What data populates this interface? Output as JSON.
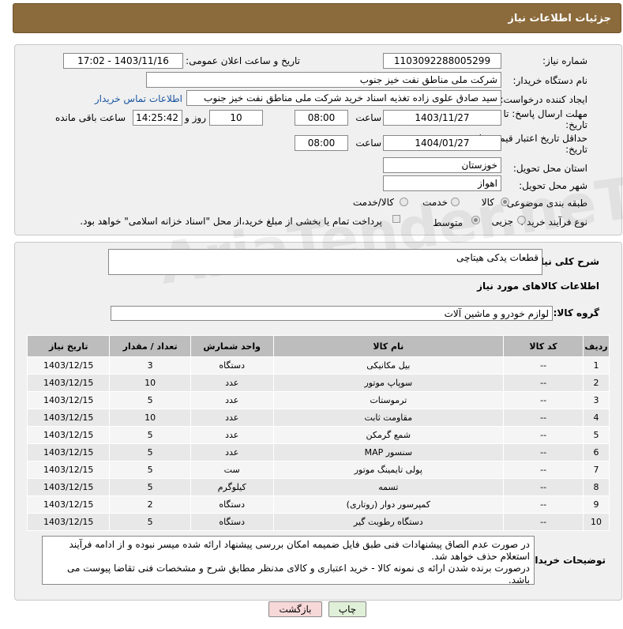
{
  "header": {
    "title": "جزئیات اطلاعات نیاز"
  },
  "form": {
    "need_number_label": "شماره نیاز:",
    "need_number": "1103092288005299",
    "announce_label": "تاریخ و ساعت اعلان عمومی:",
    "announce_value": "1403/11/16 - 17:02",
    "buyer_label": "نام دستگاه خریدار:",
    "buyer_value": "شرکت ملی مناطق نفت خیز جنوب",
    "requester_label": "ایجاد کننده درخواست:",
    "requester_value": "سید صادق علوی زاده  تغذیه اسناد خرید  شرکت ملی مناطق نفت خیز جنوب",
    "contact_link": "اطلاعات تماس خریدار",
    "deadline_label_1": "مهلت ارسال پاسخ: تا",
    "deadline_label_2": "تاریخ:",
    "deadline_date": "1403/11/27",
    "time_label": "ساعت",
    "deadline_time": "08:00",
    "days_value": "10",
    "days_label": "روز و",
    "remaining_time": "14:25:42",
    "remaining_label": "ساعت باقی مانده",
    "validity_label_1": "حداقل تاریخ اعتبار قیمت: تا",
    "validity_label_2": "تاریخ:",
    "validity_date": "1404/01/27",
    "validity_time": "08:00",
    "province_label": "استان محل تحویل:",
    "province_value": "خوزستان",
    "city_label": "شهر محل تحویل:",
    "city_value": "اهواز",
    "category_label": "طبقه بندی موضوعی:",
    "category_options": [
      "کالا",
      "خدمت",
      "کالا/خدمت"
    ],
    "process_label": "نوع فرآیند خرید :",
    "process_options": [
      "جزیی",
      "متوسط"
    ],
    "payment_note": "پرداخت تمام یا بخشی از مبلغ خرید،از محل \"اسناد خزانه اسلامی\" خواهد بود."
  },
  "details": {
    "summary_label": "شرح کلی نیاز:",
    "summary_value": "قطعات یدکی هیتاچی",
    "goods_info_title": "اطلاعات کالاهای مورد نیاز",
    "group_label": "گروه کالا:",
    "group_value": "لوازم خودرو و ماشین آلات"
  },
  "table": {
    "headers": [
      "ردیف",
      "کد کالا",
      "نام کالا",
      "واحد شمارش",
      "تعداد / مقدار",
      "تاریخ نیاز"
    ],
    "rows": [
      [
        "1",
        "--",
        "بیل مکانیکی",
        "دستگاه",
        "3",
        "1403/12/15"
      ],
      [
        "2",
        "--",
        "سوپاپ موتور",
        "عدد",
        "10",
        "1403/12/15"
      ],
      [
        "3",
        "--",
        "ترموستات",
        "عدد",
        "5",
        "1403/12/15"
      ],
      [
        "4",
        "--",
        "مقاومت ثابت",
        "عدد",
        "10",
        "1403/12/15"
      ],
      [
        "5",
        "--",
        "شمع گرمکن",
        "عدد",
        "5",
        "1403/12/15"
      ],
      [
        "6",
        "--",
        "سنسور MAP",
        "عدد",
        "5",
        "1403/12/15"
      ],
      [
        "7",
        "--",
        "پولی تایمینگ موتور",
        "ست",
        "5",
        "1403/12/15"
      ],
      [
        "8",
        "--",
        "تسمه",
        "کیلوگرم",
        "5",
        "1403/12/15"
      ],
      [
        "9",
        "--",
        "کمپرسور دوار (روتاری)",
        "دستگاه",
        "2",
        "1403/12/15"
      ],
      [
        "10",
        "--",
        "دستگاه رطوبت گیر",
        "دستگاه",
        "5",
        "1403/12/15"
      ]
    ]
  },
  "buyer_notes": {
    "label": "توضیحات خریدار:",
    "lines": [
      "در صورت عدم الصاق پیشنهادات فنی طبق فایل ضمیمه امکان بررسی پیشنهاد ارائه شده میسر نبوده و از ادامه فرآیند",
      "استعلام حذف خواهد شد.",
      "درصورت برنده شدن ارائه ی نمونه کالا - خرید اعتباری و کالای مدنظر مطابق شرح و مشخصات فنی تقاضا پیوست می باشد."
    ]
  },
  "buttons": {
    "print": "چاپ",
    "back": "بازگشت"
  },
  "watermark": "AriaTender.neT",
  "colors": {
    "header_bg": "#8b6a3b",
    "link": "#1a56a0",
    "back_btn_bg": "#f7d8d8",
    "print_btn_bg": "#e0f0d8"
  }
}
